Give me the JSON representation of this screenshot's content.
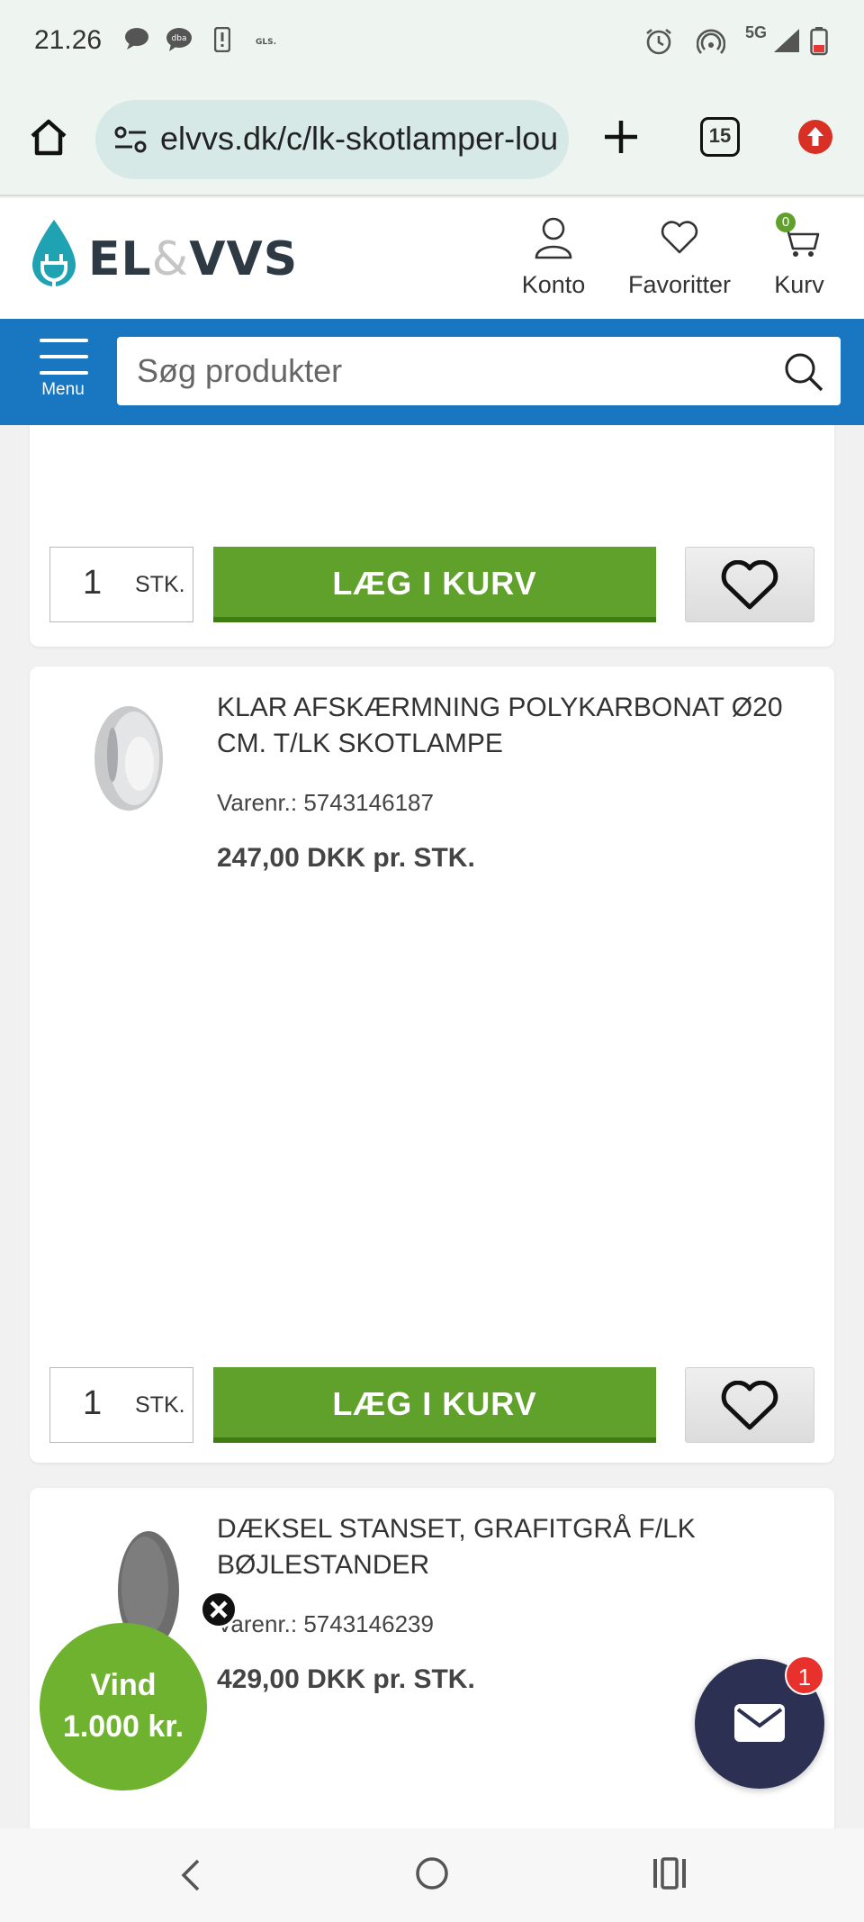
{
  "status_bar": {
    "time": "21.26",
    "network": "5G"
  },
  "browser": {
    "url": "elvvs.dk/c/lk-skotlamper-lou",
    "tab_count": "15"
  },
  "site_header": {
    "logo_left": "EL",
    "logo_amp": "&",
    "logo_right": "VVS",
    "account_label": "Konto",
    "favorites_label": "Favoritter",
    "cart_label": "Kurv",
    "cart_count": "0"
  },
  "search_bar": {
    "menu_label": "Menu",
    "placeholder": "Søg produkter"
  },
  "products": [
    {
      "qty": "1",
      "unit": "STK.",
      "add_to_cart": "LÆG I KURV"
    },
    {
      "title": "KLAR AFSKÆRMNING POLYKARBONAT Ø20 CM. T/LK SKOTLAMPE",
      "sku": "Varenr.: 5743146187",
      "price": "247,00 DKK pr. STK.",
      "qty": "1",
      "unit": "STK.",
      "add_to_cart": "LÆG I KURV"
    },
    {
      "title": "DÆKSEL STANSET, GRAFITGRÅ F/LK BØJLESTANDER",
      "sku": "Varenr.: 5743146239",
      "price": "429,00 DKK pr. STK."
    }
  ],
  "promo": {
    "line1": "Vind",
    "line2": "1.000 kr."
  },
  "chat": {
    "badge": "1"
  },
  "colors": {
    "brand_blue": "#1976c1",
    "cart_green": "#5fa12a",
    "promo_green": "#6fb22f",
    "chat_navy": "#2c3154"
  }
}
